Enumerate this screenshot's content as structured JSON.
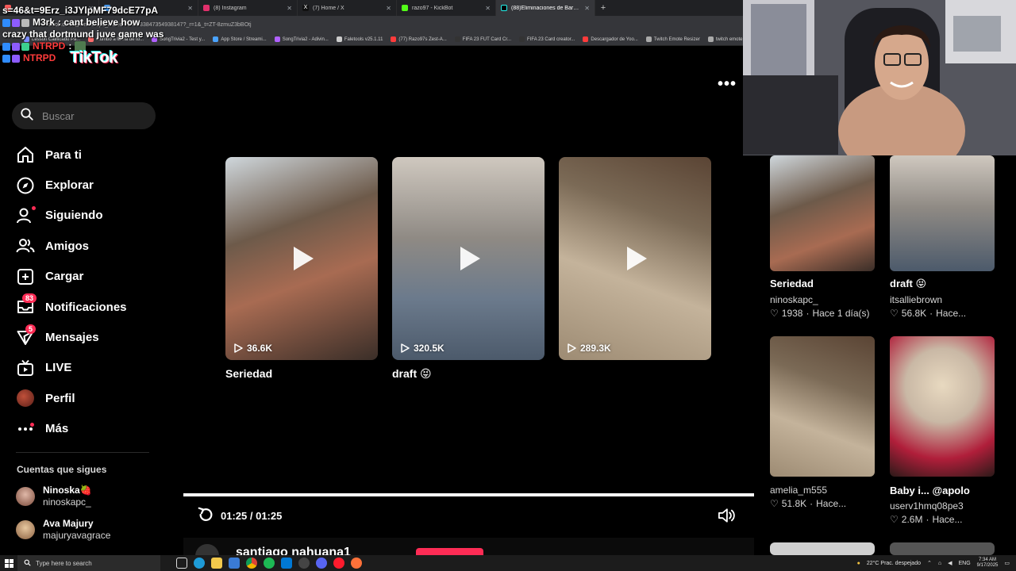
{
  "browser": {
    "tabs": [
      {
        "label": "",
        "fav": "#ff5c5c",
        "active": false
      },
      {
        "label": "",
        "fav": "#4aa3ff",
        "active": false
      },
      {
        "label": "(8) Instagram",
        "fav": "#e1306c",
        "active": false
      },
      {
        "label": "(7) Home / X",
        "fav": "#111111",
        "active": false
      },
      {
        "label": "razo97 - KickBot",
        "fav": "#53fc18",
        "active": false
      },
      {
        "label": "(88)Eliminaciones de Barc...",
        "fav": "#000000",
        "active": true
      }
    ],
    "new_tab": "+",
    "url": "tiktok.com/@ninoskapc_/video/7548933847354938147?_r=1&_t=ZT-8zmuZ3bBOtj",
    "bookmarks": [
      {
        "label": "Lesson Calificado Pa...",
        "color": "#7a8cff"
      },
      {
        "label": "Rumbo a lluvia de to...",
        "color": "#ff6b6b"
      },
      {
        "label": "SongTrivia2 - Test y...",
        "color": "#b061ff"
      },
      {
        "label": "App Store / Streami...",
        "color": "#4aa3ff"
      },
      {
        "label": "SongTrivia2 - Adivin...",
        "color": "#b061ff"
      },
      {
        "label": "Faletools v25.1.11",
        "color": "#cccccc"
      },
      {
        "label": "(77) Razo97s Zest-A...",
        "color": "#ff3b3b"
      },
      {
        "label": "FIFA 23 FUT Card Cr...",
        "color": "#333333"
      },
      {
        "label": "FIFA 23 Card creator...",
        "color": "#333333"
      },
      {
        "label": "Descargador de Yoo...",
        "color": "#ff3b3b"
      },
      {
        "label": "Twitch Emote Resizer",
        "color": "#aaaaaa"
      },
      {
        "label": "twitch emote resizer...",
        "color": "#aaaaaa"
      }
    ]
  },
  "chat": {
    "line1": "s=46&t=9Erz_i3JYlpMF79dcE77pA",
    "line2_user": "M3rk",
    "line2_msg": ": cant believe how",
    "line3": "crazy that dortmund juve game was",
    "line4_user": "NTRPD",
    "line4_msg": ":",
    "line5_user": "NTRPD",
    "logo": "TikTok"
  },
  "sidebar": {
    "search_placeholder": "Buscar",
    "nav": [
      {
        "label": "Para ti",
        "icon": "home-icon",
        "badge": ""
      },
      {
        "label": "Explorar",
        "icon": "compass-icon",
        "badge": ""
      },
      {
        "label": "Siguiendo",
        "icon": "following-icon",
        "badge": ""
      },
      {
        "label": "Amigos",
        "icon": "friends-icon",
        "badge": ""
      },
      {
        "label": "Cargar",
        "icon": "upload-icon",
        "badge": ""
      },
      {
        "label": "Notificaciones",
        "icon": "inbox-icon",
        "badge": "83"
      },
      {
        "label": "Mensajes",
        "icon": "messages-icon",
        "badge": "5"
      },
      {
        "label": "LIVE",
        "icon": "live-icon",
        "badge": ""
      },
      {
        "label": "Perfil",
        "icon": "avatar-icon",
        "badge": ""
      },
      {
        "label": "Más",
        "icon": "more-icon",
        "badge": ""
      }
    ],
    "following_title": "Cuentas que sigues",
    "following": [
      {
        "name": "Ninoska🍓",
        "user": "ninoskapc_",
        "color": "#c98a7a"
      },
      {
        "name": "Ava Majury",
        "user": "majuryavagrace",
        "color": "#b89070"
      }
    ]
  },
  "main": {
    "more_label": "•••",
    "cards": [
      {
        "views": "36.6K",
        "title": "Seriedad",
        "colors": [
          "#6d5a4a",
          "#a86b52",
          "#3a2e28"
        ]
      },
      {
        "views": "320.5K",
        "title": "draft 😝",
        "colors": [
          "#8f8a84",
          "#cfc8bf",
          "#4c5a6b"
        ]
      },
      {
        "views": "289.3K",
        "title": "",
        "colors": [
          "#7b6a56",
          "#c4b39b",
          "#5a4434"
        ]
      }
    ],
    "time": "01:25 / 01:25",
    "progress": 1.0,
    "next_user": "santiago nahuana1"
  },
  "right": {
    "items": [
      {
        "title": "Seriedad",
        "user": "ninoskapc_",
        "likes": "1938",
        "time": "Hace 1 día(s)",
        "colors": [
          "#6d5a4a",
          "#a86b52"
        ]
      },
      {
        "title": "draft 😝",
        "user": "itsalliebrown",
        "likes": "56.8K",
        "time": "Hace...",
        "colors": [
          "#8f8a84",
          "#cfc8bf"
        ]
      },
      {
        "title": "",
        "user": "amelia_m555",
        "likes": "51.8K",
        "time": "Hace...",
        "colors": [
          "#7b6a56",
          "#c4b39b"
        ]
      },
      {
        "title": "Baby i... @apolo",
        "user": "userv1hmq08pe3",
        "likes": "2.6M",
        "time": "Hace...",
        "colors": [
          "#c9b8a5",
          "#e8d9c0"
        ]
      }
    ]
  },
  "taskbar": {
    "search_placeholder": "Type here to search",
    "weather": "22°C  Prac. despejado",
    "lang": "ENG",
    "time": "7:34 AM",
    "date": "9/17/2025"
  },
  "accent": "#fe2c55"
}
